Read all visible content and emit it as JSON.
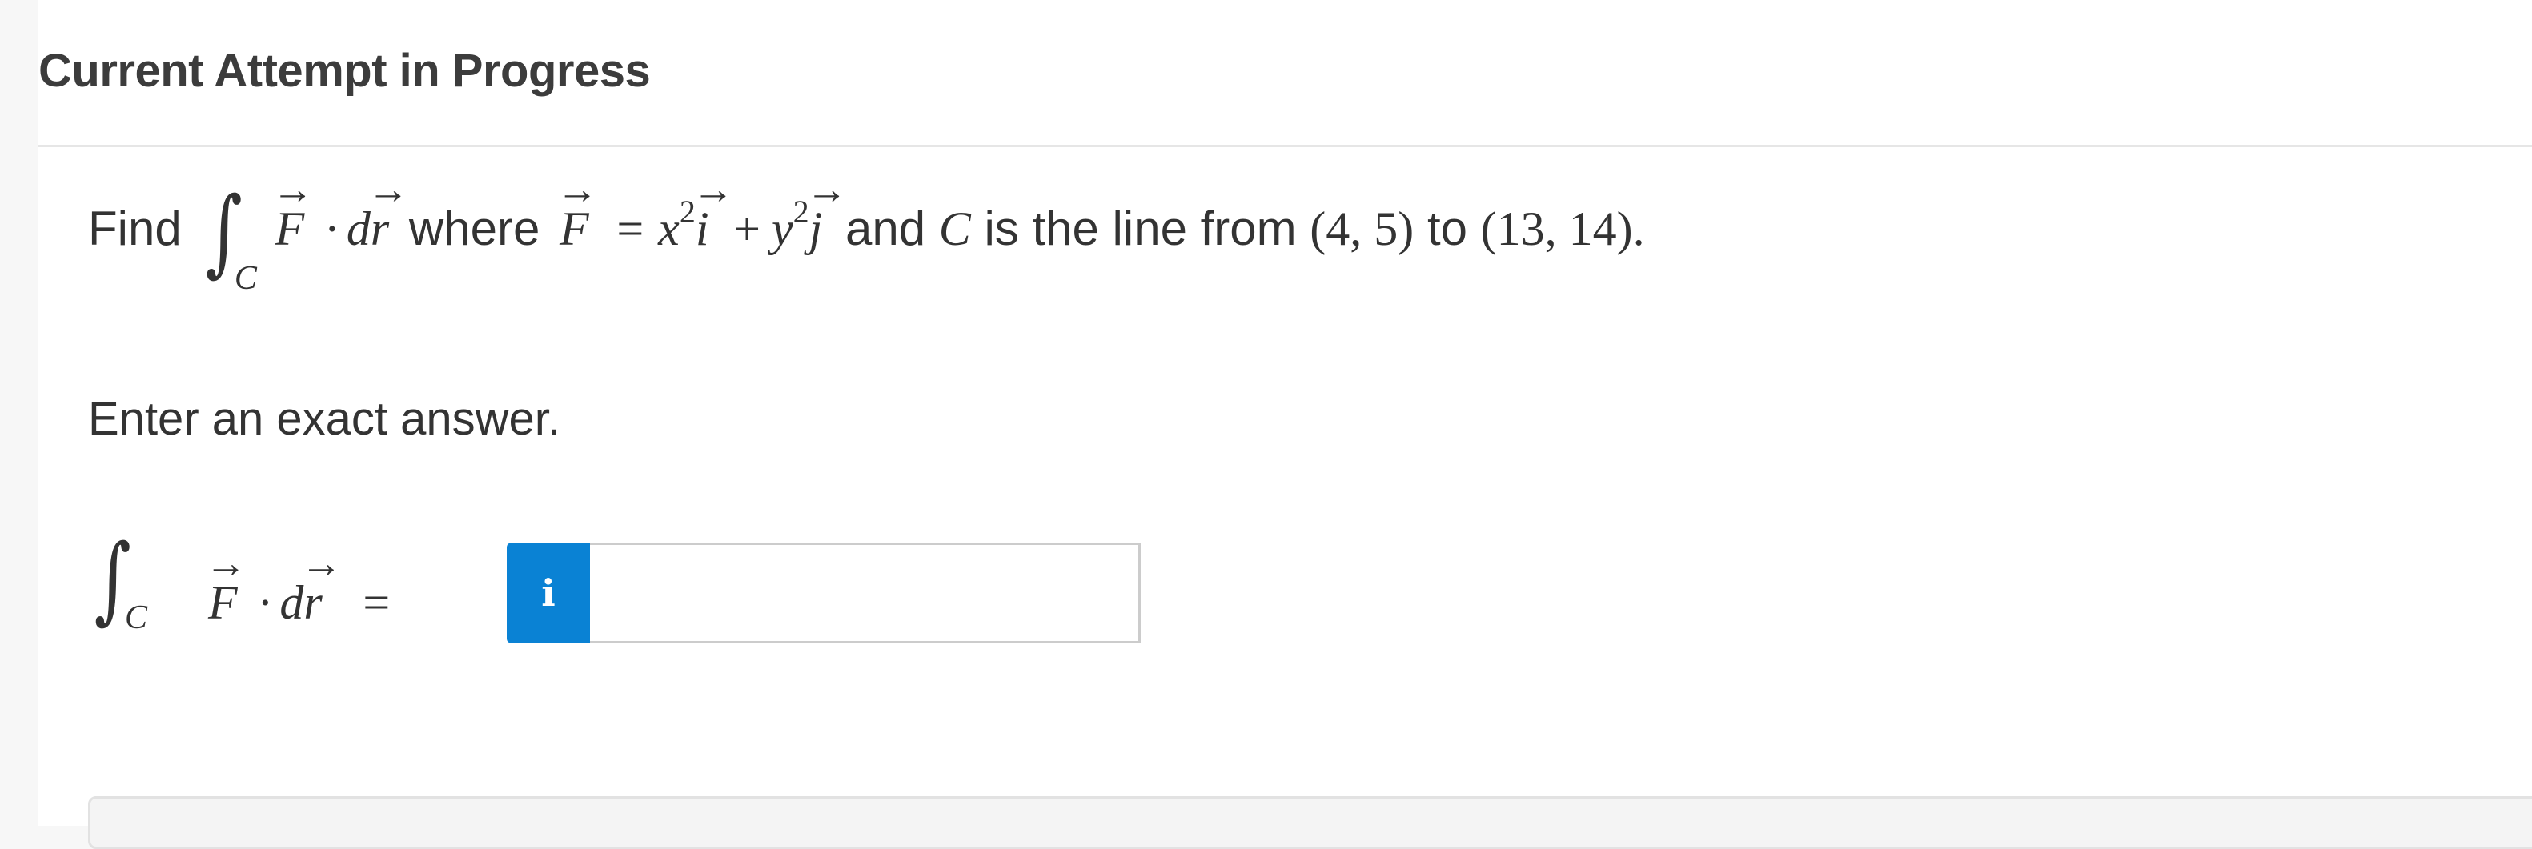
{
  "header": {
    "title": "Current Attempt in Progress"
  },
  "question": {
    "find_word": "Find",
    "integral_sign": "∫",
    "curve_symbol": "C",
    "vector_F": "F",
    "vector_r": "r",
    "vector_i": "i",
    "vector_j": "j",
    "arrow": "⃗",
    "dot_op": "·",
    "d": "d",
    "where_word": "where",
    "equals": "=",
    "x": "x",
    "y": "y",
    "exponent": "2",
    "plus": "+",
    "and_word": "and",
    "line_phrase": "is the line from",
    "point_start": "(4, 5)",
    "to_word": "to",
    "point_end": "(13, 14)",
    "period": "."
  },
  "instructions": {
    "text": "Enter an exact answer."
  },
  "answer": {
    "info_icon_glyph": "i",
    "input_value": "",
    "input_placeholder": ""
  },
  "colors": {
    "info_button_bg": "#0a82d4",
    "text": "#333333",
    "page_bg": "#ffffff",
    "gutter_bg": "#f7f7f7"
  }
}
